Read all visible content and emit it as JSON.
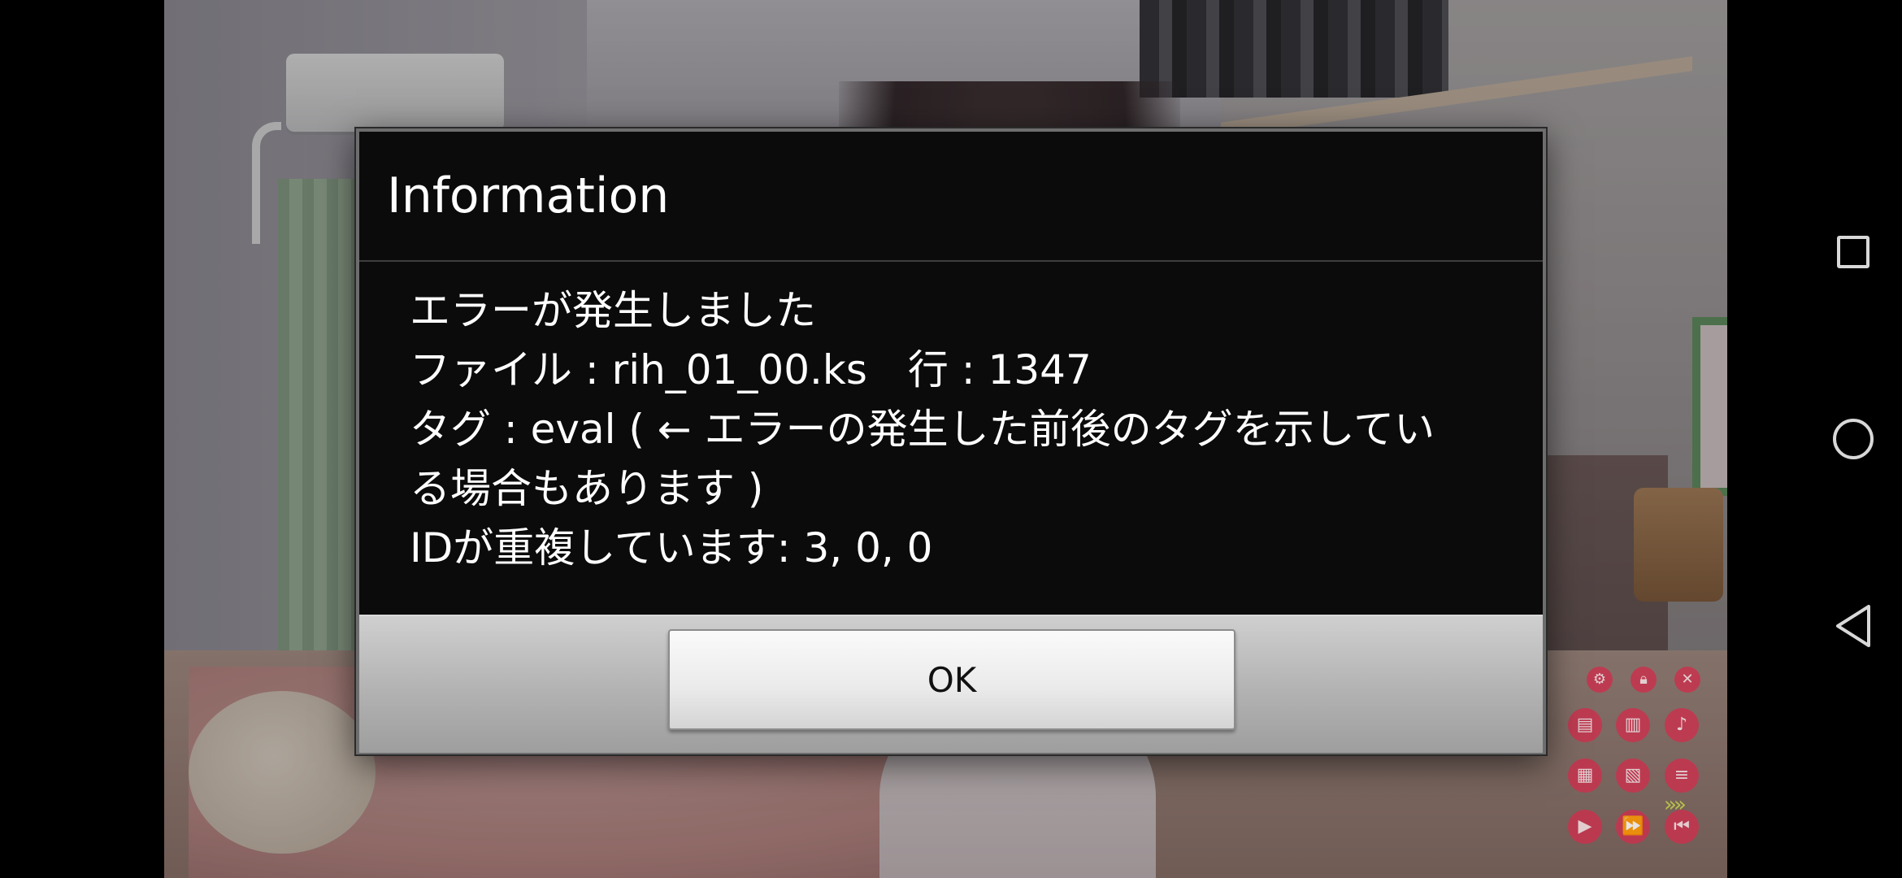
{
  "dialog": {
    "title": "Information",
    "message_lines": [
      "エラーが発生しました",
      "ファイル : rih_01_00.ks　行 : 1347",
      "タグ : eval ( ← エラーの発生した前後のタグを示してい",
      "る場合もあります )",
      "IDが重複しています: 3, 0, 0"
    ],
    "ok_label": "OK"
  },
  "game_menu": {
    "icons": [
      "gear-icon",
      "lock-icon",
      "close-icon",
      "save-icon",
      "load-icon",
      "voice-icon",
      "quick-save-icon",
      "quick-load-icon",
      "log-icon",
      "auto-icon",
      "skip-icon",
      "back-icon"
    ]
  },
  "nav_bar": {
    "icons": [
      "recents-icon",
      "home-icon",
      "back-icon"
    ]
  },
  "colors": {
    "dialog_bg": "#0b0b0b",
    "dialog_text": "#ffffff",
    "button_bar": "#b2b2b2",
    "game_button": "#c8334e"
  }
}
